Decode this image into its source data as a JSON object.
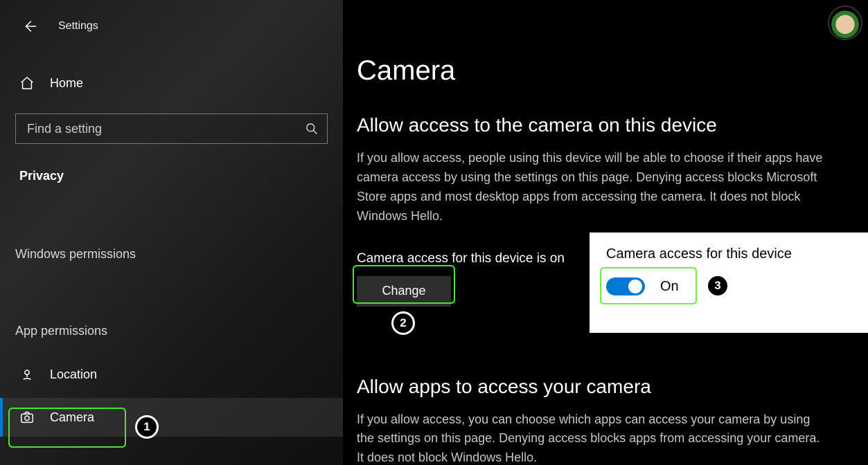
{
  "titlebar": {
    "title": "Settings"
  },
  "sidebar": {
    "home_label": "Home",
    "search_placeholder": "Find a setting",
    "section_privacy": "Privacy",
    "section_windows_permissions": "Windows permissions",
    "section_app_permissions": "App permissions",
    "items": {
      "location": {
        "label": "Location"
      },
      "camera": {
        "label": "Camera"
      }
    }
  },
  "main": {
    "page_title": "Camera",
    "h_allow_device": "Allow access to the camera on this device",
    "body_allow_device": "If you allow access, people using this device will be able to choose if their apps have camera access by using the settings on this page. Denying access blocks Microsoft Store apps and most desktop apps from accessing the camera. It does not block Windows Hello.",
    "status_line": "Camera access for this device is on",
    "change_label": "Change",
    "h_allow_apps": "Allow apps to access your camera",
    "body_allow_apps": "If you allow access, you can choose which apps can access your camera by using the settings on this page. Denying access blocks apps from accessing your camera. It does not block Windows Hello."
  },
  "popup": {
    "title": "Camera access for this device",
    "state_label": "On",
    "state_on": true
  },
  "annotations": {
    "b1": "1",
    "b2": "2",
    "b3": "3"
  }
}
